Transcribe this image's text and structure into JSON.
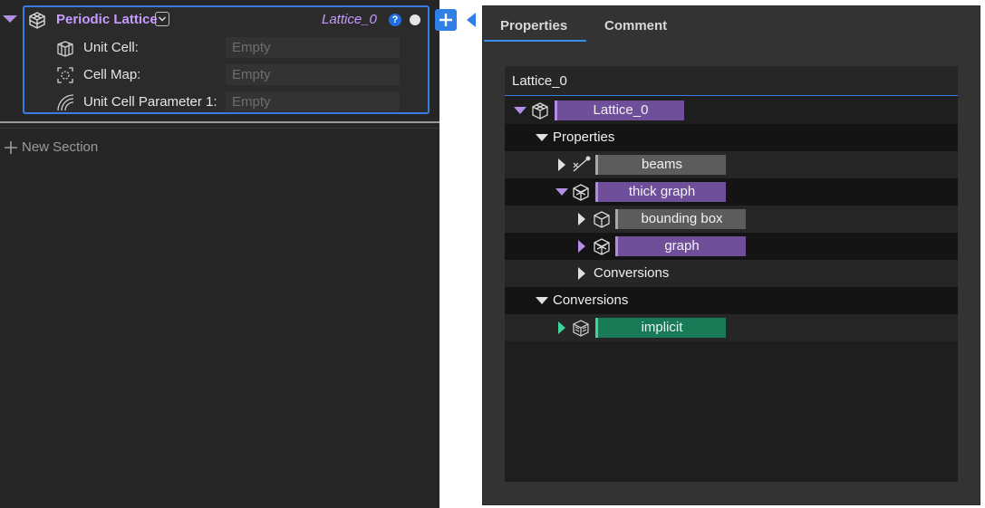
{
  "left": {
    "section_title": "Periodic Lattice",
    "output_name": "Lattice_0",
    "help_label": "?",
    "rows": [
      {
        "label": "Unit Cell:",
        "placeholder": "Empty",
        "icon": "unit-cell-icon"
      },
      {
        "label": "Cell Map:",
        "placeholder": "Empty",
        "icon": "cell-map-icon"
      },
      {
        "label": "Unit Cell Parameter 1:",
        "placeholder": "Empty",
        "icon": "parameter-icon"
      }
    ],
    "new_section_label": "New Section"
  },
  "tabs": [
    "Properties",
    "Comment"
  ],
  "tree": {
    "header": "Lattice_0",
    "nodes": [
      {
        "label": "Lattice_0",
        "style": "purple"
      },
      {
        "label": "Properties",
        "style": "text"
      },
      {
        "label": "beams",
        "style": "gray"
      },
      {
        "label": "thick graph",
        "style": "purple"
      },
      {
        "label": "bounding box",
        "style": "gray"
      },
      {
        "label": "graph",
        "style": "purple"
      },
      {
        "label": "Conversions",
        "style": "text"
      },
      {
        "label": "Conversions",
        "style": "text"
      },
      {
        "label": "implicit",
        "style": "green"
      }
    ]
  },
  "colors": {
    "accent_blue": "#3a7de0",
    "purple_chip": "#6f4f9a",
    "gray_chip": "#5c5c5c",
    "green_chip": "#187a56",
    "title_purple": "#c79bff"
  }
}
